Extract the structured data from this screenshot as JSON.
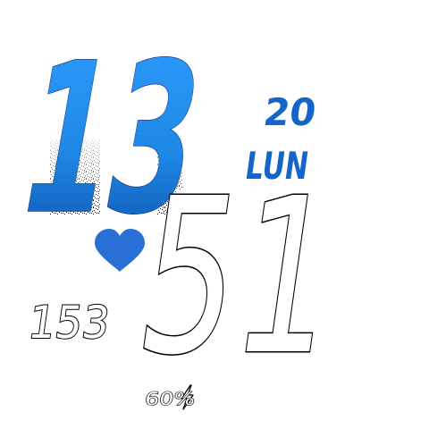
{
  "time": {
    "hours": "13",
    "minutes": "51"
  },
  "date": {
    "day": "20",
    "weekday": "LUN"
  },
  "heart_rate": {
    "value": "153",
    "icon": "heart-icon"
  },
  "battery": {
    "text": "60%",
    "level_percent": 60,
    "icon": "lightning-bolt-icon"
  },
  "colors": {
    "accent": "#1e88e5",
    "accent_dark": "#1565c8",
    "heart": "#2a6fd6",
    "background": "#ffffff",
    "outline": "#000000"
  }
}
